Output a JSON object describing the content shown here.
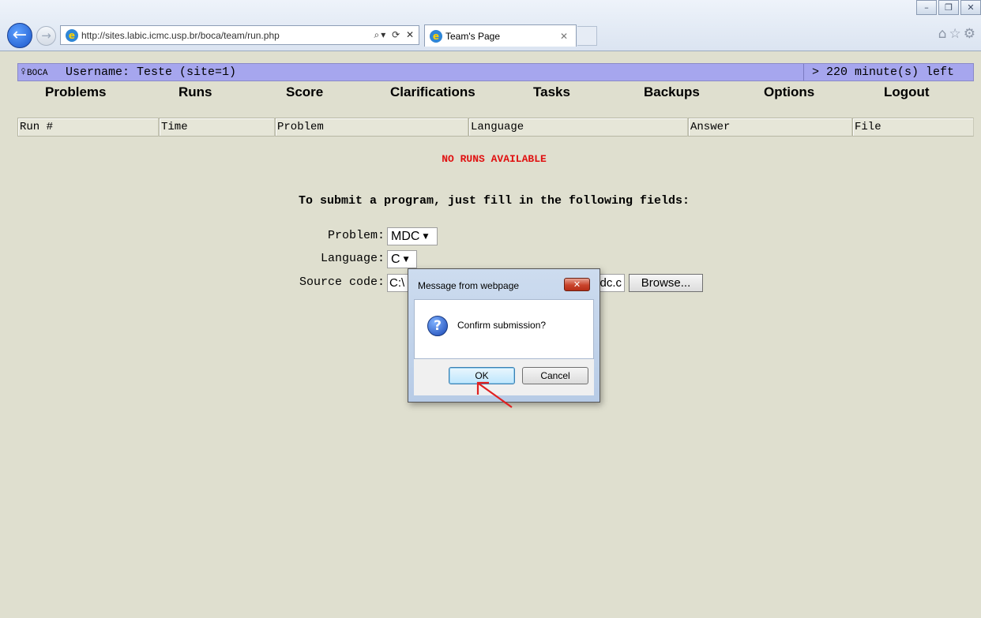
{
  "browser": {
    "url": "http://sites.labic.icmc.usp.br/boca/team/run.php",
    "tab_title": "Team's Page",
    "window_buttons": [
      "minimize",
      "restore",
      "close"
    ]
  },
  "header": {
    "logo_main": "BOCA",
    "username_text": "Username: Teste (site=1)",
    "time_left": "> 220 minute(s) left"
  },
  "nav": [
    {
      "label": "Problems"
    },
    {
      "label": "Runs"
    },
    {
      "label": "Score"
    },
    {
      "label": "Clarifications"
    },
    {
      "label": "Tasks"
    },
    {
      "label": "Backups"
    },
    {
      "label": "Options"
    },
    {
      "label": "Logout"
    }
  ],
  "runs_table": {
    "columns": [
      "Run #",
      "Time",
      "Problem",
      "Language",
      "Answer",
      "File"
    ],
    "empty_message": "NO RUNS AVAILABLE"
  },
  "submit_form": {
    "instructions": "To submit a program, just fill in the following fields:",
    "problem_label": "Problem:",
    "problem_value": "MDC",
    "language_label": "Language:",
    "language_value": "C",
    "source_label": "Source code:",
    "source_value_start": "C:\\",
    "source_value_end": "dc.c",
    "browse_label": "Browse..."
  },
  "dialog": {
    "title": "Message from webpage",
    "message": "Confirm submission?",
    "ok_label": "OK",
    "cancel_label": "Cancel",
    "close_glyph": "✕"
  },
  "colors": {
    "page_bg": "#dfdfcf",
    "header_bar": "#a6a6ee",
    "empty_message": "#e01010",
    "annotation_arrow": "#e02020"
  }
}
